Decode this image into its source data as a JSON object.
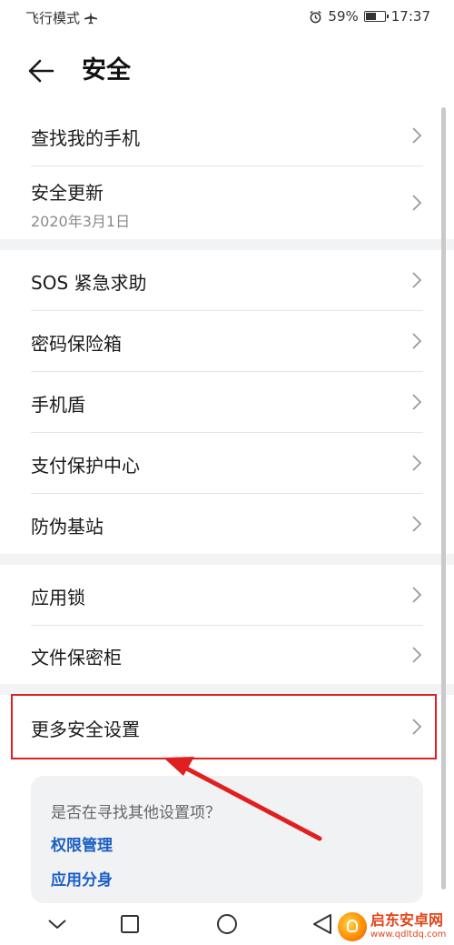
{
  "status_bar": {
    "mode_text": "飞行模式",
    "battery_percent": "59%",
    "battery_level": 0.59,
    "time": "17:37"
  },
  "header": {
    "title": "安全"
  },
  "groups": [
    [
      {
        "label": "查找我的手机"
      },
      {
        "label": "安全更新",
        "sub": "2020年3月1日"
      }
    ],
    [
      {
        "label": "SOS 紧急求助"
      },
      {
        "label": "密码保险箱"
      },
      {
        "label": "手机盾"
      },
      {
        "label": "支付保护中心"
      },
      {
        "label": "防伪基站"
      }
    ],
    [
      {
        "label": "应用锁"
      },
      {
        "label": "文件保密柜"
      }
    ],
    [
      {
        "label": "更多安全设置"
      }
    ]
  ],
  "suggestions": {
    "question": "是否在寻找其他设置项？",
    "links": [
      "权限管理",
      "应用分身"
    ]
  },
  "watermark": {
    "name": "启东安卓网",
    "url": "www.qdltdq.com"
  },
  "colors": {
    "accent_link": "#1b5fc4",
    "highlight": "#e02020",
    "group_gap": "#f1f3f5"
  }
}
